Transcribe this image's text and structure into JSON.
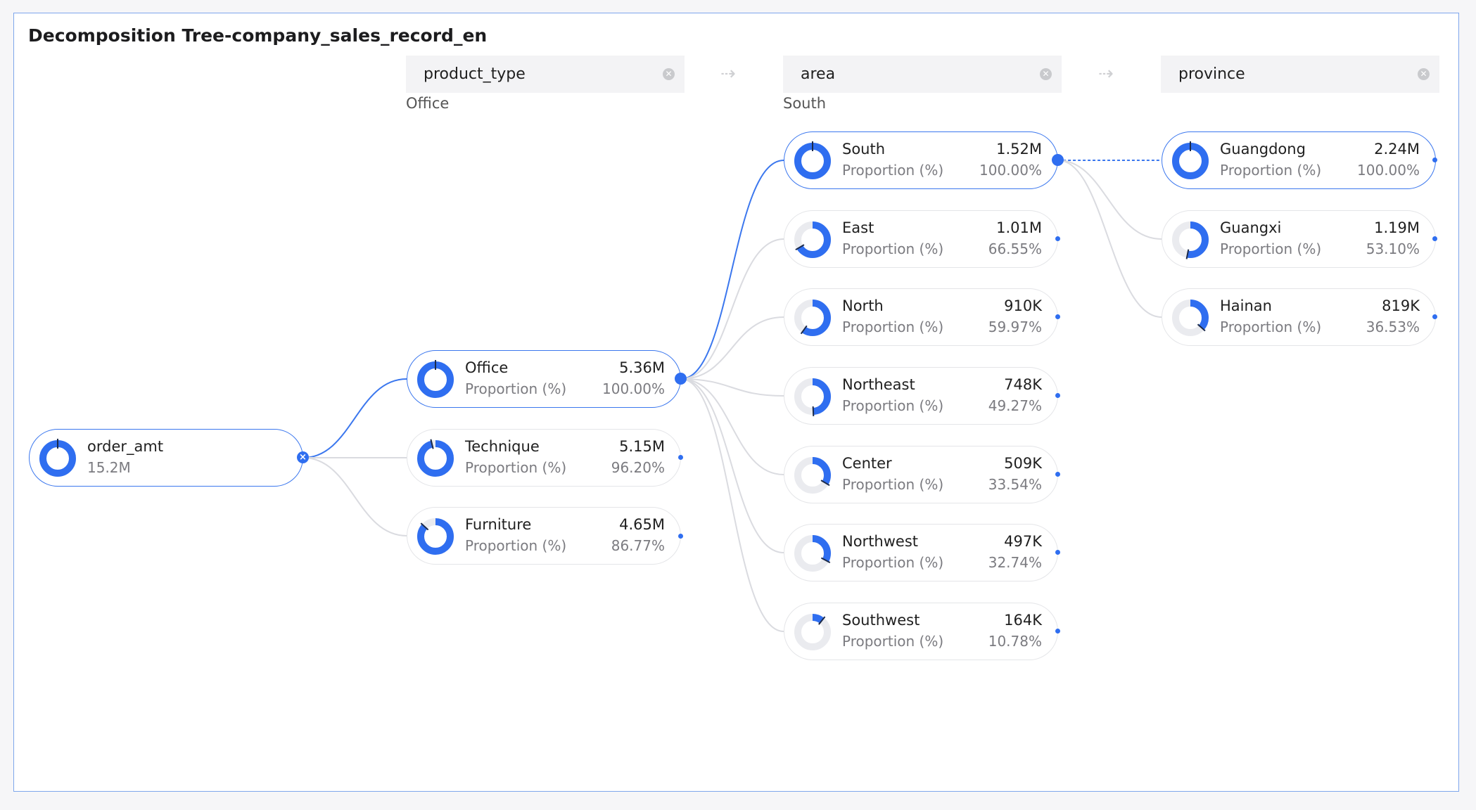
{
  "title": "Decomposition Tree-company_sales_record_en",
  "colors": {
    "accent": "#2f6ef0",
    "track": "#eaebef",
    "border": "#7ea6ec",
    "link": "#dadbe0"
  },
  "levels": [
    {
      "label": "product_type",
      "filter": "Office"
    },
    {
      "label": "area",
      "filter": "South"
    },
    {
      "label": "province",
      "filter": ""
    }
  ],
  "root": {
    "label": "order_amt",
    "value": "15.2M",
    "fraction": 1.0
  },
  "product_type_nodes": [
    {
      "label": "Office",
      "value": "5.36M",
      "sub": "Proportion (%)",
      "pct": "100.00%",
      "fraction": 1.0
    },
    {
      "label": "Technique",
      "value": "5.15M",
      "sub": "Proportion (%)",
      "pct": "96.20%",
      "fraction": 0.962
    },
    {
      "label": "Furniture",
      "value": "4.65M",
      "sub": "Proportion (%)",
      "pct": "86.77%",
      "fraction": 0.8677
    }
  ],
  "area_nodes": [
    {
      "label": "South",
      "value": "1.52M",
      "sub": "Proportion (%)",
      "pct": "100.00%",
      "fraction": 1.0
    },
    {
      "label": "East",
      "value": "1.01M",
      "sub": "Proportion (%)",
      "pct": "66.55%",
      "fraction": 0.6655
    },
    {
      "label": "North",
      "value": "910K",
      "sub": "Proportion (%)",
      "pct": "59.97%",
      "fraction": 0.5997
    },
    {
      "label": "Northeast",
      "value": "748K",
      "sub": "Proportion (%)",
      "pct": "49.27%",
      "fraction": 0.4927
    },
    {
      "label": "Center",
      "value": "509K",
      "sub": "Proportion (%)",
      "pct": "33.54%",
      "fraction": 0.3354
    },
    {
      "label": "Northwest",
      "value": "497K",
      "sub": "Proportion (%)",
      "pct": "32.74%",
      "fraction": 0.3274
    },
    {
      "label": "Southwest",
      "value": "164K",
      "sub": "Proportion (%)",
      "pct": "10.78%",
      "fraction": 0.1078
    }
  ],
  "province_nodes": [
    {
      "label": "Guangdong",
      "value": "2.24M",
      "sub": "Proportion (%)",
      "pct": "100.00%",
      "fraction": 1.0
    },
    {
      "label": "Guangxi",
      "value": "1.19M",
      "sub": "Proportion (%)",
      "pct": "53.10%",
      "fraction": 0.531
    },
    {
      "label": "Hainan",
      "value": "819K",
      "sub": "Proportion (%)",
      "pct": "36.53%",
      "fraction": 0.3653
    }
  ]
}
